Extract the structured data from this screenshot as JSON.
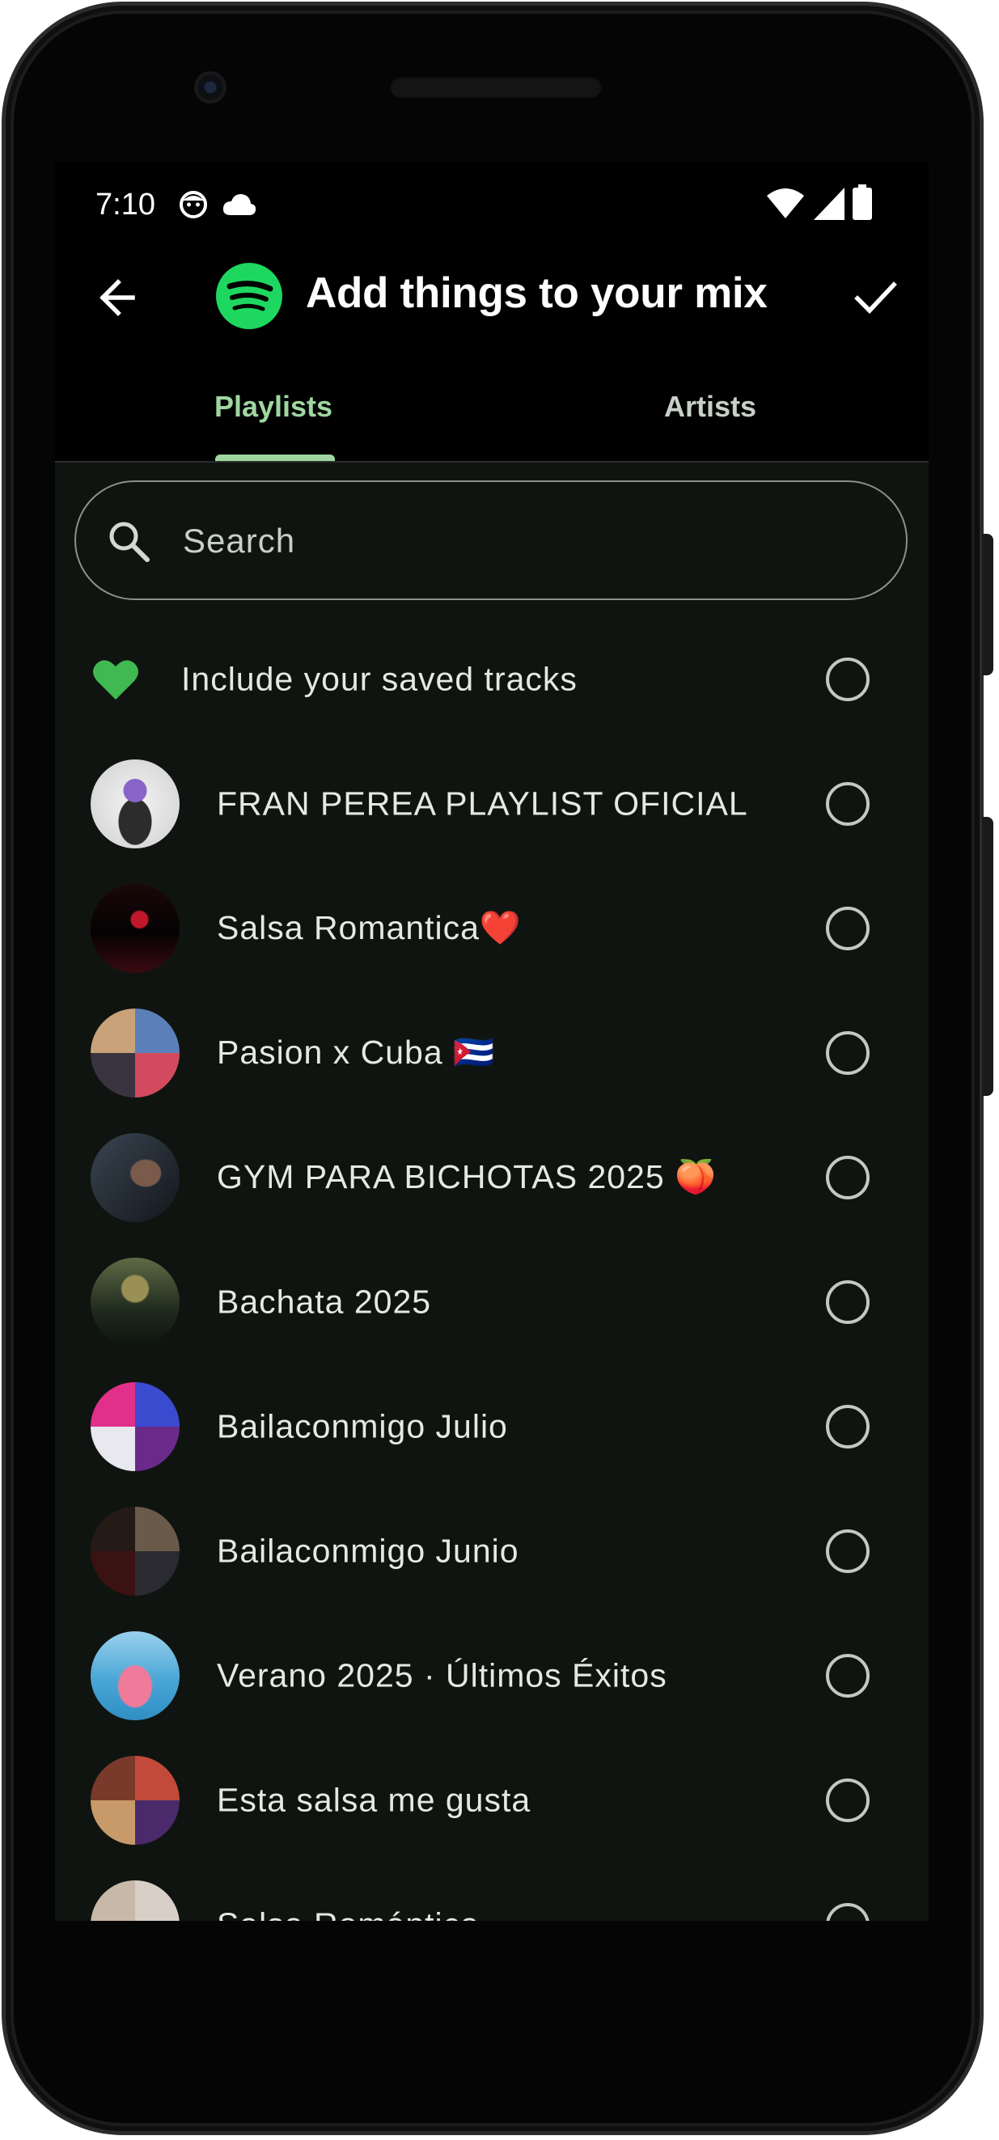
{
  "status_bar": {
    "time": "7:10",
    "left_icons": [
      "face-notification-icon",
      "cloud-icon"
    ],
    "right_icons": [
      "wifi-icon",
      "cellular-icon",
      "battery-icon"
    ]
  },
  "app_bar": {
    "back_icon": "arrow-left-icon",
    "logo": "spotify-logo",
    "title": "Add things to your mix",
    "confirm_icon": "check-icon"
  },
  "tabs": [
    {
      "label": "Playlists",
      "active": true
    },
    {
      "label": "Artists",
      "active": false
    }
  ],
  "search": {
    "placeholder": "Search",
    "value": ""
  },
  "saved_tracks": {
    "label": "Include your saved tracks",
    "icon": "heart-icon",
    "selected": false
  },
  "playlists": [
    {
      "name": "FRAN PEREA PLAYLIST OFICIAL",
      "selected": false
    },
    {
      "name": "Salsa Romantica❤️",
      "selected": false
    },
    {
      "name": "Pasion x Cuba 🇨🇺",
      "selected": false
    },
    {
      "name": "GYM PARA BICHOTAS 2025 🍑",
      "selected": false
    },
    {
      "name": "Bachata 2025",
      "selected": false
    },
    {
      "name": "Bailaconmigo Julio",
      "selected": false
    },
    {
      "name": "Bailaconmigo Junio",
      "selected": false
    },
    {
      "name": "Verano 2025 · Últimos Éxitos",
      "selected": false
    },
    {
      "name": "Esta salsa me gusta",
      "selected": false
    },
    {
      "name": "Salsa Romántica",
      "selected": false
    }
  ],
  "colors": {
    "accent": "#9fd6a0",
    "spotify_green": "#1ed760",
    "heart_green": "#3fb950",
    "list_background": "#0f1410"
  }
}
